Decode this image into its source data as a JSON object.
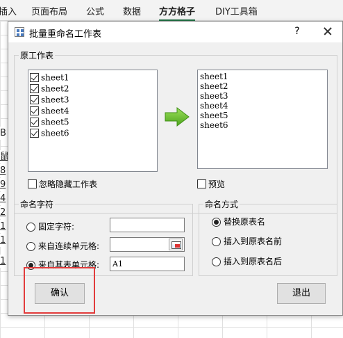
{
  "ribbon": {
    "tabs": [
      "插入",
      "页面布局",
      "公式",
      "数据",
      "方方格子",
      "DIY工具箱"
    ]
  },
  "sheet": {
    "col_header": "B",
    "row_fragments": [
      "鼠",
      "8",
      "9",
      "4",
      "2",
      "1",
      "1",
      "1"
    ]
  },
  "dialog": {
    "title": "批量重命名工作表",
    "help_label": "?",
    "source_group": {
      "label": "原工作表",
      "sheets": [
        {
          "name": "sheet1",
          "checked": true
        },
        {
          "name": "sheet2",
          "checked": true
        },
        {
          "name": "sheet3",
          "checked": true
        },
        {
          "name": "sheet4",
          "checked": true
        },
        {
          "name": "sheet5",
          "checked": true
        },
        {
          "name": "sheet6",
          "checked": true
        }
      ],
      "preview_list": [
        "sheet1",
        "sheet2",
        "sheet3",
        "sheet4",
        "sheet5",
        "sheet6"
      ],
      "ignore_hidden_label": "忽略隐藏工作表",
      "ignore_hidden_checked": false,
      "preview_label": "预览",
      "preview_checked": false
    },
    "naming_chars": {
      "label": "命名字符",
      "options": [
        {
          "label": "固定字符:",
          "selected": false,
          "value": ""
        },
        {
          "label": "来自连续单元格:",
          "selected": false,
          "value": ""
        },
        {
          "label": "来自其表单元格:",
          "selected": true,
          "value": "A1"
        }
      ]
    },
    "naming_method": {
      "label": "命名方式",
      "options": [
        {
          "label": "替换原表名",
          "selected": true
        },
        {
          "label": "插入到原表名前",
          "selected": false
        },
        {
          "label": "插入到原表名后",
          "selected": false
        }
      ]
    },
    "confirm_label": "确认",
    "exit_label": "退出",
    "accent_color": "#6cc32b",
    "highlight_color": "#e23b3b"
  }
}
